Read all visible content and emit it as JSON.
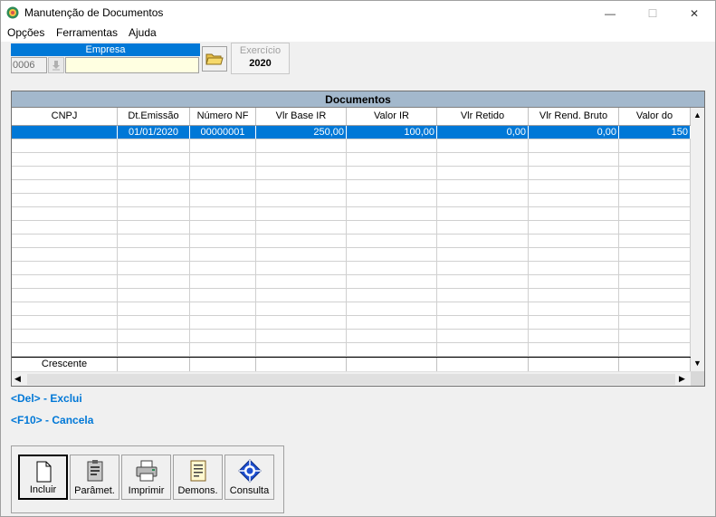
{
  "window": {
    "title": "Manutenção de Documentos",
    "minimize": "—",
    "maximize": "☐",
    "close": "✕"
  },
  "menu": {
    "items": [
      "Opções",
      "Ferramentas",
      "Ajuda"
    ]
  },
  "empresa": {
    "label": "Empresa",
    "code": "0006",
    "name": ""
  },
  "exercicio": {
    "label": "Exercício",
    "value": "2020"
  },
  "grid": {
    "title": "Documentos",
    "columns": [
      "CNPJ",
      "Dt.Emissão",
      "Número NF",
      "Vlr Base IR",
      "Valor IR",
      "Vlr Retido",
      "Vlr Rend. Bruto",
      "Valor do"
    ],
    "rows": [
      [
        "",
        "01/01/2020",
        "00000001",
        "250,00",
        "100,00",
        "0,00",
        "0,00",
        "150"
      ]
    ],
    "footer": [
      "Crescente",
      "",
      "",
      "",
      "",
      "",
      "",
      ""
    ]
  },
  "hints": {
    "del": "<Del> - Exclui",
    "f10": "<F10> - Cancela"
  },
  "toolbar": {
    "buttons": [
      "Incluir",
      "Parâmet.",
      "Imprimir",
      "Demons.",
      "Consulta"
    ]
  },
  "colors": {
    "accent": "#0078d7",
    "grid_title_bg": "#a3b8cc",
    "empresa_input_bg": "#ffffe1"
  }
}
